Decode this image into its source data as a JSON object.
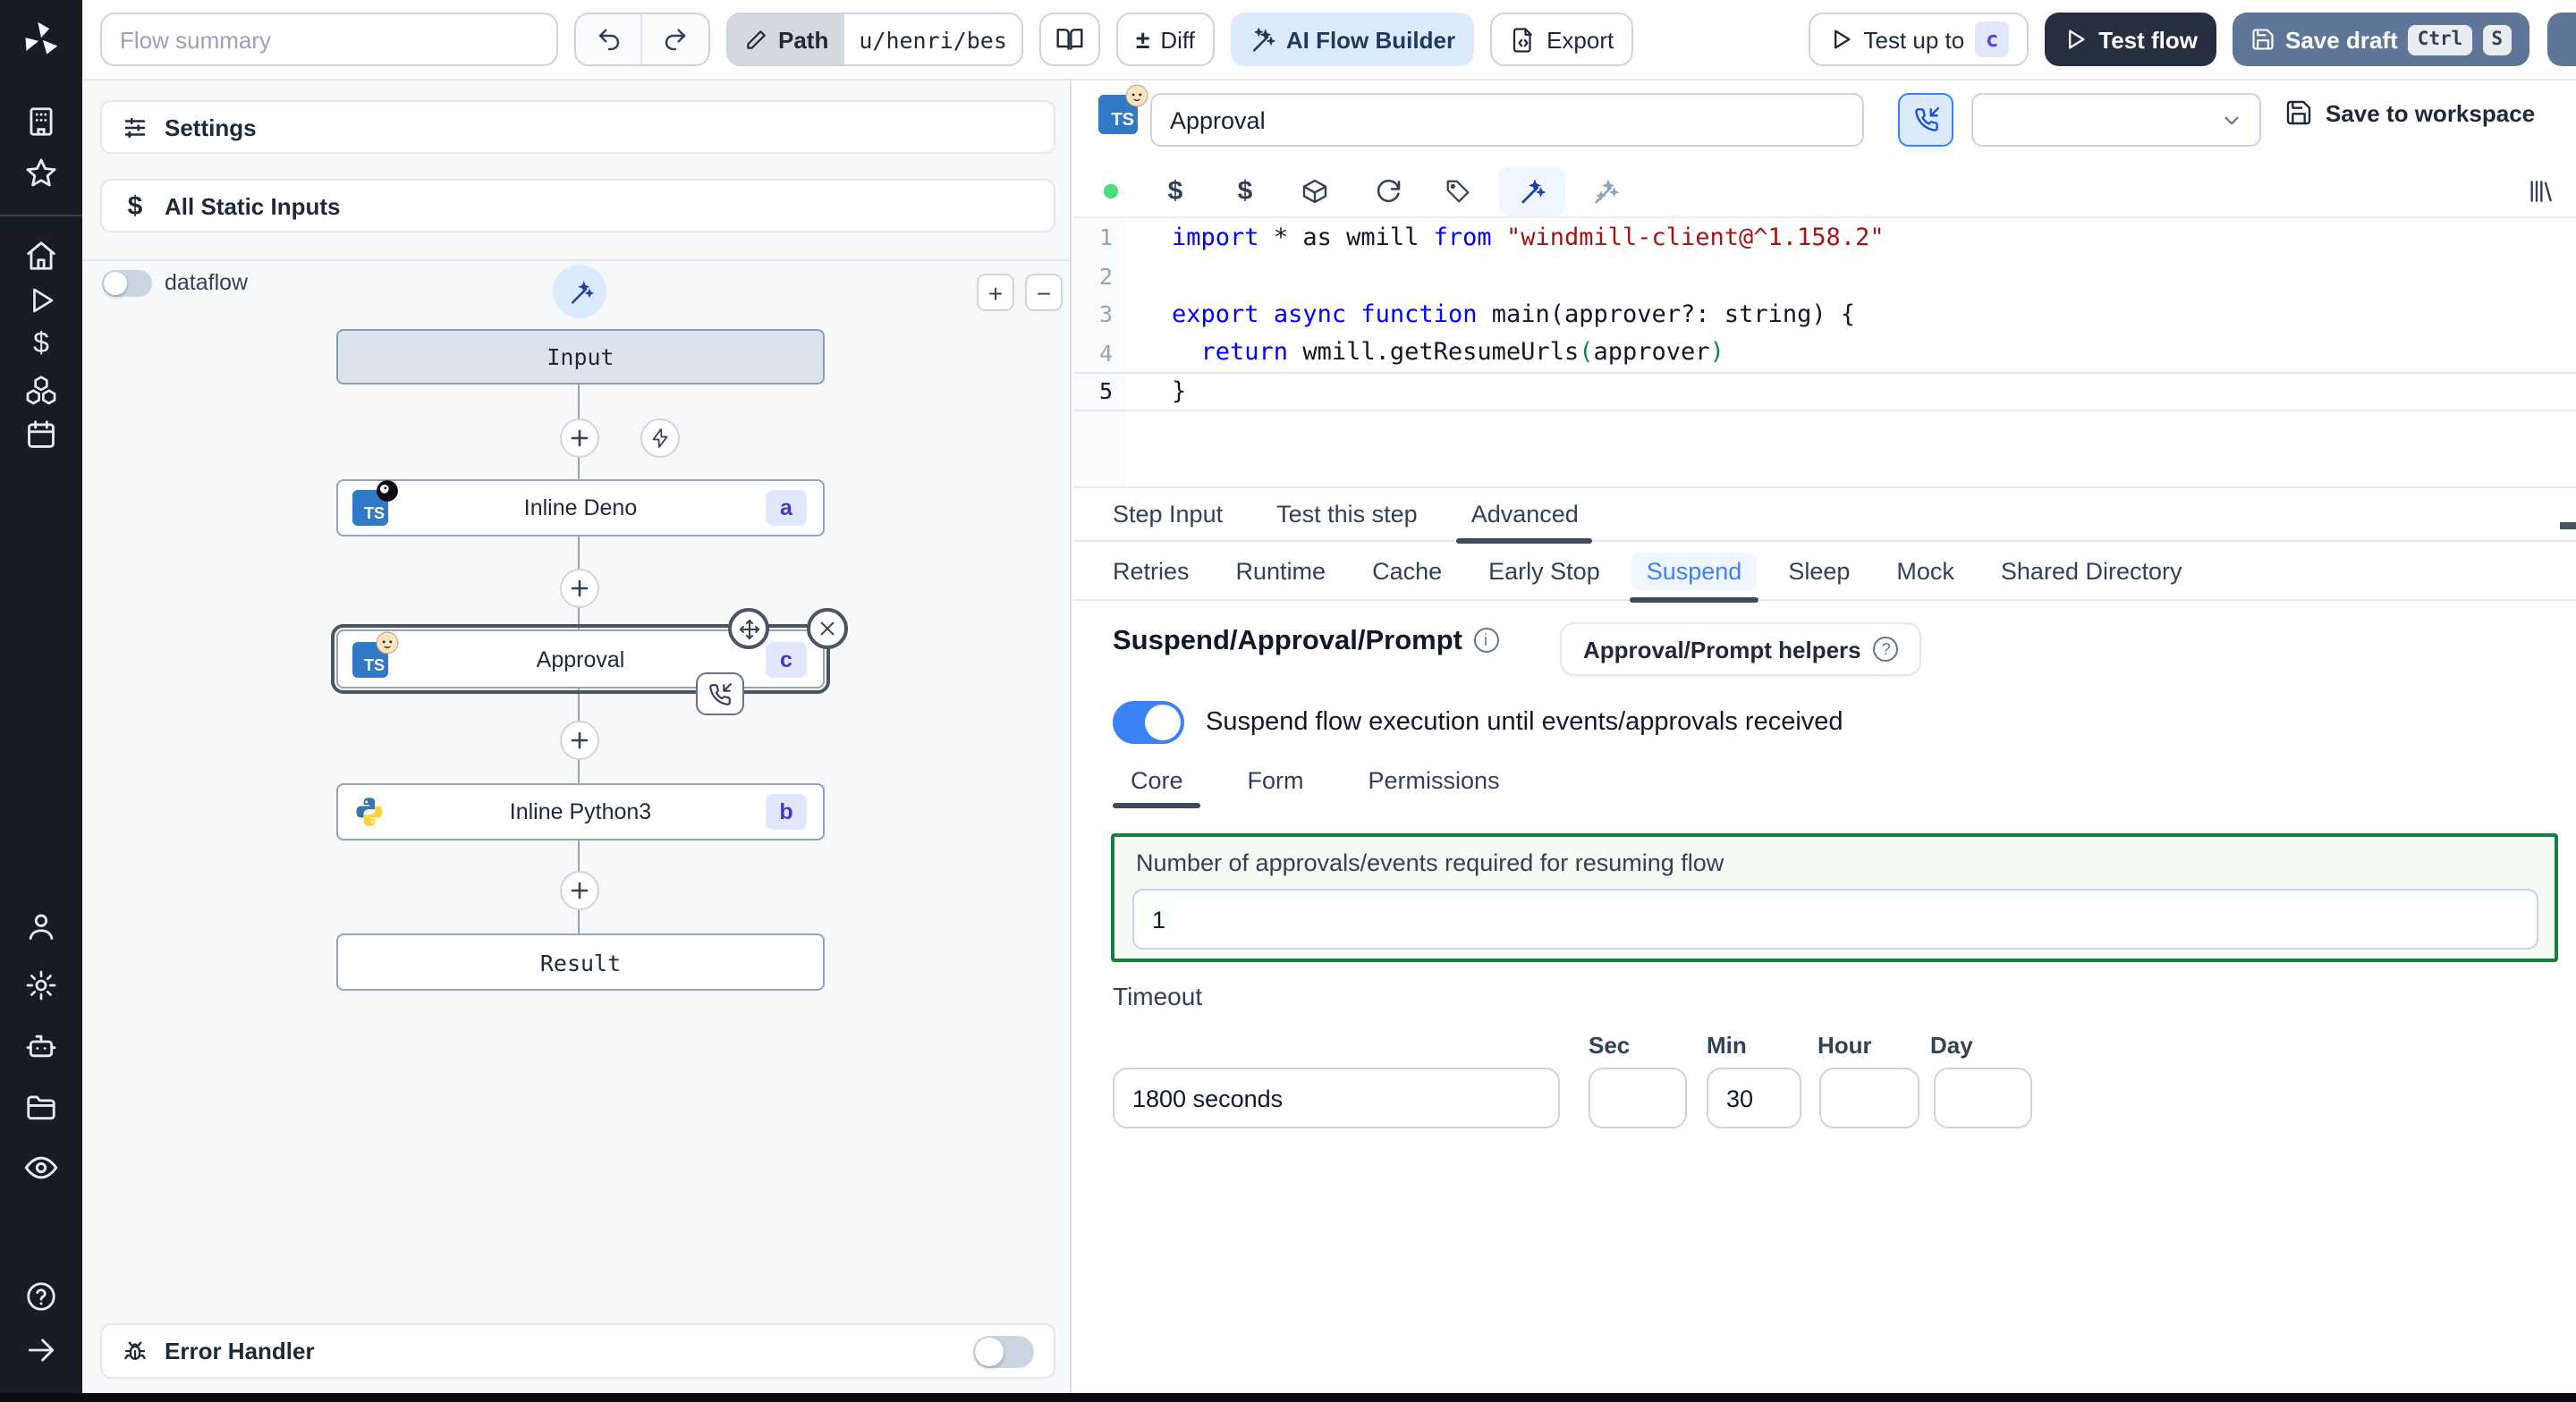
{
  "colors": {
    "accent_blue": "#3b82f6",
    "ai_btn_bg": "#dbeafe",
    "dark_btn": "#262f40",
    "save_draft_btn": "#5f7698",
    "badge_bg": "#e0e7ff",
    "badge_text": "#4338ca",
    "green_border": "#15803d",
    "sidebar_bg": "#171b23",
    "keyword": "#0000ff",
    "string": "#a31515"
  },
  "icons": {
    "logo": "windmill-pinwheel",
    "toolbar": [
      "undo",
      "redo",
      "pencil",
      "book-open",
      "plus-minus-diff",
      "magic-wand",
      "file-export",
      "play",
      "save"
    ],
    "sidebar": [
      "building",
      "star",
      "home",
      "play",
      "dollar",
      "cubes",
      "calendar",
      "user",
      "gear",
      "robot",
      "folder",
      "eye",
      "help-circle",
      "arrow-right"
    ],
    "editor_toolbar": [
      "status-dot",
      "dollar",
      "dollar",
      "package",
      "refresh",
      "tag",
      "magic-wand",
      "sparkle-wand",
      "library"
    ]
  },
  "topbar": {
    "flow_summary_placeholder": "Flow summary",
    "path_label": "Path",
    "path_value": "u/henri/bes",
    "diff_label": "Diff",
    "diff_icon": "±",
    "ai_builder_label": "AI Flow Builder",
    "export_label": "Export",
    "test_up_to_label": "Test up to",
    "test_up_to_badge": "c",
    "test_flow_label": "Test flow",
    "save_draft_label": "Save draft",
    "kbd_ctrl": "Ctrl",
    "kbd_s": "S"
  },
  "left": {
    "settings": "Settings",
    "static_inputs": "All Static Inputs",
    "static_inputs_icon": "$",
    "dataflow": "dataflow",
    "zoom_in": "+",
    "zoom_out": "−",
    "error_handler": "Error Handler",
    "graph": {
      "input": "Input",
      "result": "Result",
      "steps": [
        {
          "label": "Inline Deno",
          "badge": "a"
        },
        {
          "label": "Approval",
          "badge": "c"
        },
        {
          "label": "Inline Python3",
          "badge": "b"
        }
      ]
    }
  },
  "right": {
    "step_name": "Approval",
    "save_to_workspace": "Save to workspace",
    "code": {
      "lines": [
        {
          "n": "1",
          "tokens": {
            "a": "import",
            "b": " * as wmill ",
            "c": "from",
            "d": " \"windmill-client@^1.158.2\""
          }
        },
        {
          "n": "2"
        },
        {
          "n": "3",
          "tokens": {
            "a": "export",
            "b": " ",
            "c": "async",
            "d": " ",
            "e": "function",
            "f": " main(approver?: string) {"
          }
        },
        {
          "n": "4",
          "tokens": {
            "a": "  ",
            "b": "return",
            "c": " wmill.getResumeUrls",
            "d": "(",
            "e": "approver",
            "f": ")"
          }
        },
        {
          "n": "5",
          "tokens": {
            "a": "}"
          }
        }
      ]
    },
    "tabs": {
      "t0": "Step Input",
      "t1": "Test this step",
      "t2": "Advanced"
    },
    "subtabs": {
      "s0": "Retries",
      "s1": "Runtime",
      "s2": "Cache",
      "s3": "Early Stop",
      "s4": "Suspend",
      "s5": "Sleep",
      "s6": "Mock",
      "s7": "Shared Directory"
    },
    "suspend": {
      "title": "Suspend/Approval/Prompt",
      "helpers": "Approval/Prompt helpers",
      "toggle_text": "Suspend flow execution until events/approvals received",
      "core": "Core",
      "form": "Form",
      "permissions": "Permissions",
      "approvals_label": "Number of approvals/events required for resuming flow",
      "approvals_value": "1",
      "timeout_label": "Timeout",
      "timeout_value": "1800 seconds",
      "sec_label": "Sec",
      "min_label": "Min",
      "hour_label": "Hour",
      "day_label": "Day",
      "sec_value": "",
      "min_value": "30",
      "hour_value": "",
      "day_value": ""
    }
  }
}
